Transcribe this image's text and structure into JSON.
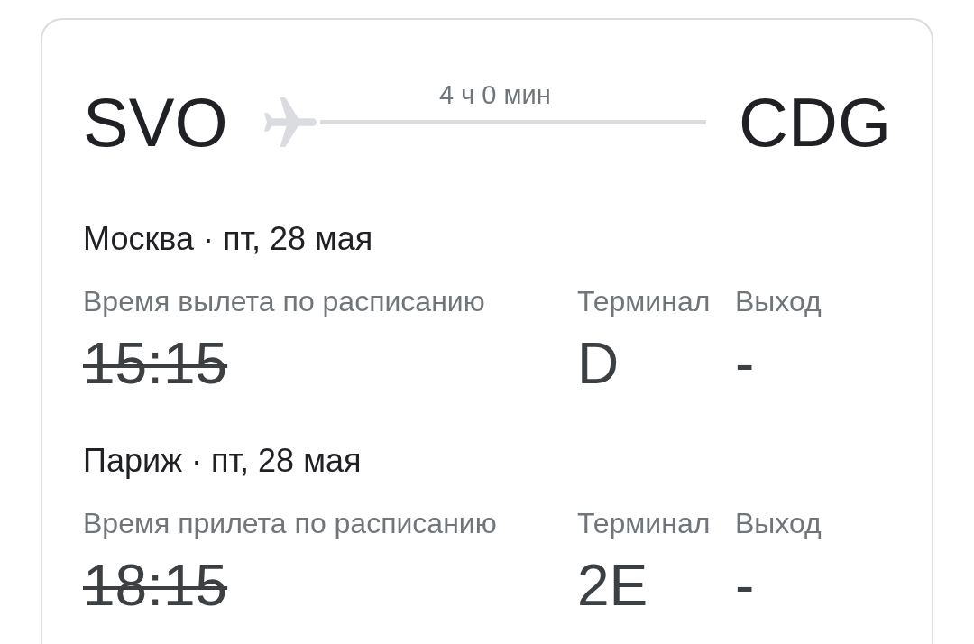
{
  "route": {
    "origin": "SVO",
    "duration": "4 ч 0 мин",
    "destination": "CDG"
  },
  "legs": [
    {
      "place": "Москва · пт, 28 мая",
      "time_label": "Время вылета по расписанию",
      "terminal_label": "Терминал",
      "gate_label": "Выход",
      "time": "15:15",
      "strikethrough": true,
      "terminal": "D",
      "gate": "-"
    },
    {
      "place": "Париж · пт, 28 мая",
      "time_label": "Время прилета по расписанию",
      "terminal_label": "Терминал",
      "gate_label": "Выход",
      "time": "18:15",
      "strikethrough": true,
      "terminal": "2E",
      "gate": "-"
    }
  ]
}
